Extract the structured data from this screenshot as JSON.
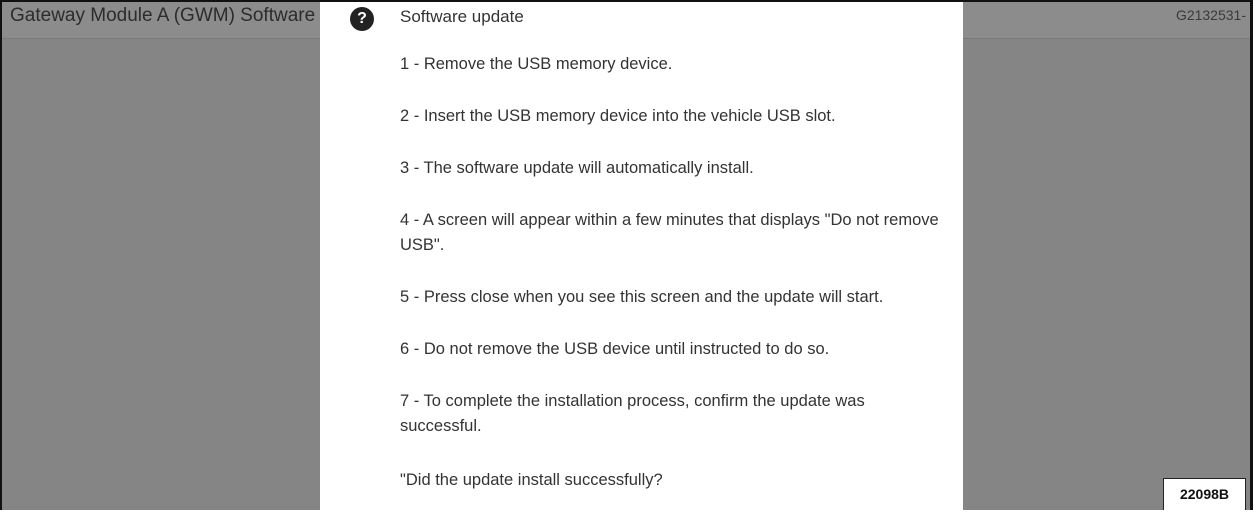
{
  "background": {
    "title": "Gateway Module A (GWM) Software",
    "code": "G2132531-"
  },
  "dialog": {
    "icon": "question-mark-icon",
    "title": "Software update",
    "steps": [
      "1 - Remove the USB memory device.",
      "2 - Insert the USB memory device into the vehicle USB slot.",
      "3 - The software update will automatically install.",
      "4 - A screen will appear within a few minutes that displays \"Do not remove USB\".",
      "5 - Press close when you see this screen and the update will start.",
      "6 - Do not remove the USB device until instructed to do so.",
      "7 - To complete the installation process, confirm the update was successful."
    ],
    "question": "\"Did the update install successfully?"
  },
  "figure_id": "22098B"
}
